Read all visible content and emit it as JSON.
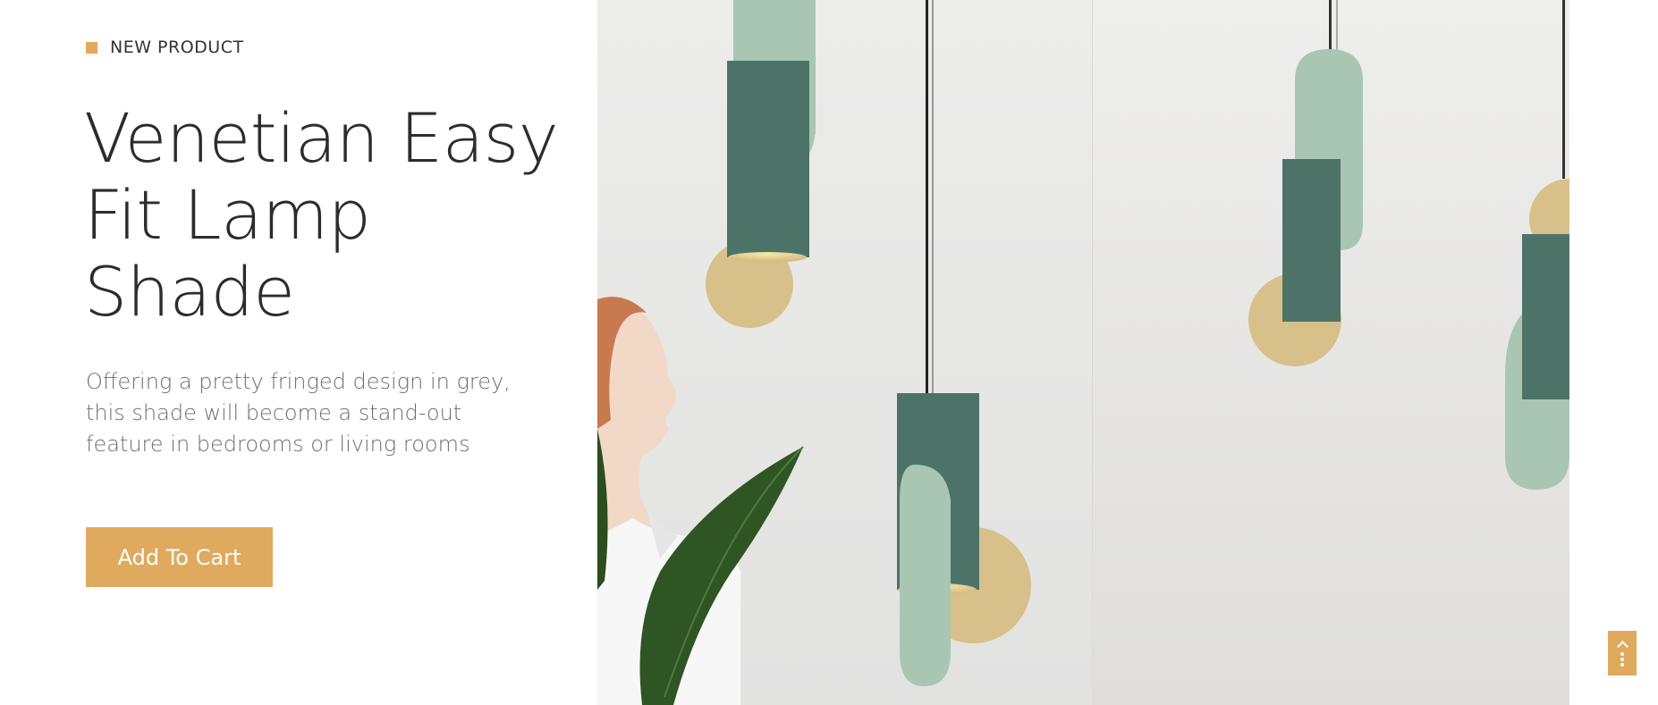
{
  "hero": {
    "eyebrow": "NEW PRODUCT",
    "title_lines": [
      "Venetian Easy",
      "Fit Lamp",
      "Shade"
    ],
    "description": "Offering a pretty fringed design in grey, this shade will become a stand-out feature in bedrooms or living rooms",
    "cta_label": "Add To Cart"
  },
  "image": {
    "subject": "pendant-lamps-with-woman-and-leaf"
  },
  "colors": {
    "accent": "#dfa95e",
    "lamp_dark": "#4d7369",
    "lamp_light": "#a9c6b3",
    "brass": "#d8c08a",
    "background_left": "#e8e8e8",
    "background_right": "#e3e2df"
  },
  "icons": {
    "scroll_widget": "scroll-up-menu-icon"
  }
}
